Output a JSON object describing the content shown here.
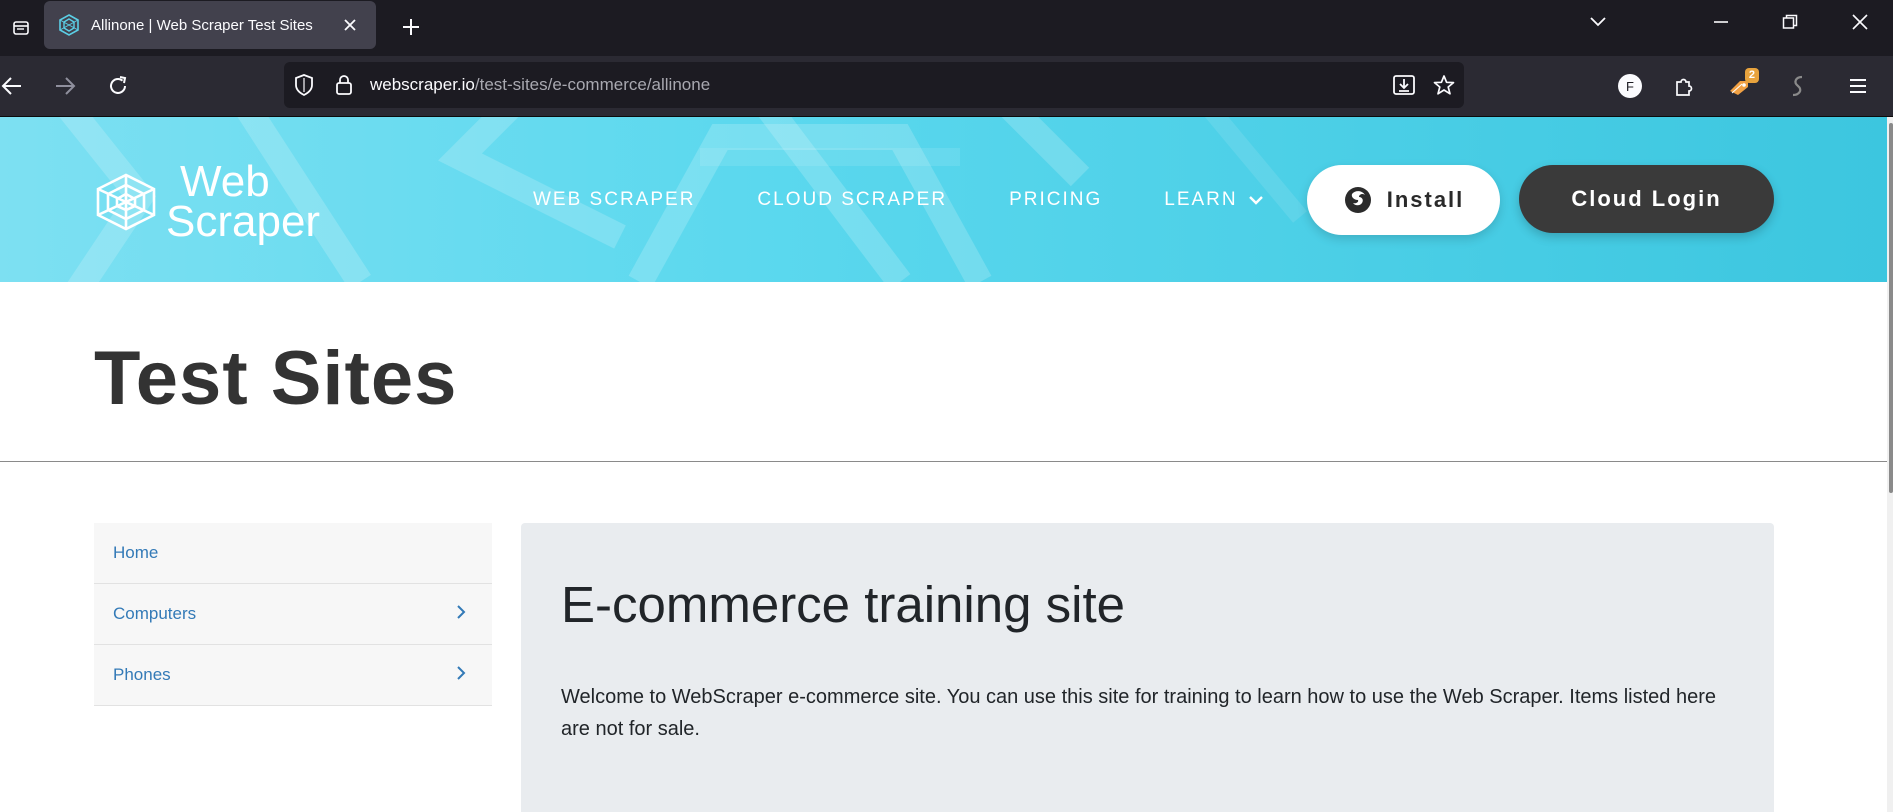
{
  "browser": {
    "tab": {
      "title": "Allinone | Web Scraper Test Sites"
    },
    "url": {
      "domain": "webscraper.io",
      "path": "/test-sites/e-commerce/allinone"
    },
    "profile_initial": "F",
    "extension_badge": "2"
  },
  "header": {
    "logo": {
      "line1": "Web",
      "line2": "Scraper"
    },
    "nav": [
      {
        "label": "WEB SCRAPER"
      },
      {
        "label": "CLOUD SCRAPER"
      },
      {
        "label": "PRICING"
      },
      {
        "label": "LEARN"
      }
    ],
    "install_label": "Install",
    "cloud_login_label": "Cloud Login"
  },
  "page": {
    "title": "Test Sites"
  },
  "sidebar": {
    "items": [
      {
        "label": "Home"
      },
      {
        "label": "Computers"
      },
      {
        "label": "Phones"
      }
    ]
  },
  "jumbotron": {
    "heading": "E-commerce training site",
    "text": "Welcome to WebScraper e-commerce site. You can use this site for training to learn how to use the Web Scraper. Items listed here are not for sale."
  },
  "colors": {
    "header_gradient_start": "#7de0f2",
    "header_gradient_end": "#3cc6df",
    "link": "#337ab7",
    "jumbotron_bg": "#e9ecef",
    "cloud_login_bg": "#3a3a3a"
  }
}
